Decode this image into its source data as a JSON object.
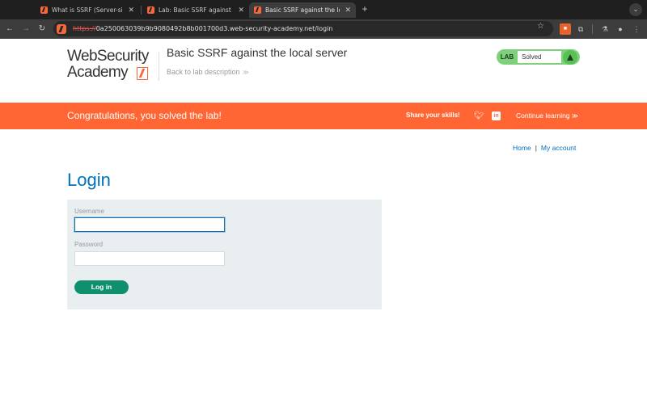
{
  "browser": {
    "tabs": [
      {
        "title": "What is SSRF (Server-side re"
      },
      {
        "title": "Lab: Basic SSRF against the l"
      },
      {
        "title": "Basic SSRF against the local s"
      }
    ],
    "url_scheme": "https://",
    "url_rest": "0a250063039b9b9080492b8b001700d3.web-security-academy.net/login"
  },
  "header": {
    "logo_line1": "WebSecurity",
    "logo_line2": "Academy",
    "lab_title": "Basic SSRF against the local server",
    "back_link": "Back to lab description",
    "status_tag": "LAB",
    "status_text": "Solved"
  },
  "banner": {
    "message": "Congratulations, you solved the lab!",
    "share_label": "Share your skills!",
    "continue_label": "Continue learning"
  },
  "nav": {
    "home": "Home",
    "separator": "|",
    "account": "My account"
  },
  "login": {
    "heading": "Login",
    "username_label": "Username",
    "username_value": "",
    "password_label": "Password",
    "submit_label": "Log in"
  },
  "colors": {
    "brand_orange": "#ff6633",
    "link_blue": "#0071bc",
    "button_green": "#0f8f6e",
    "solved_green": "#7fd07a"
  }
}
